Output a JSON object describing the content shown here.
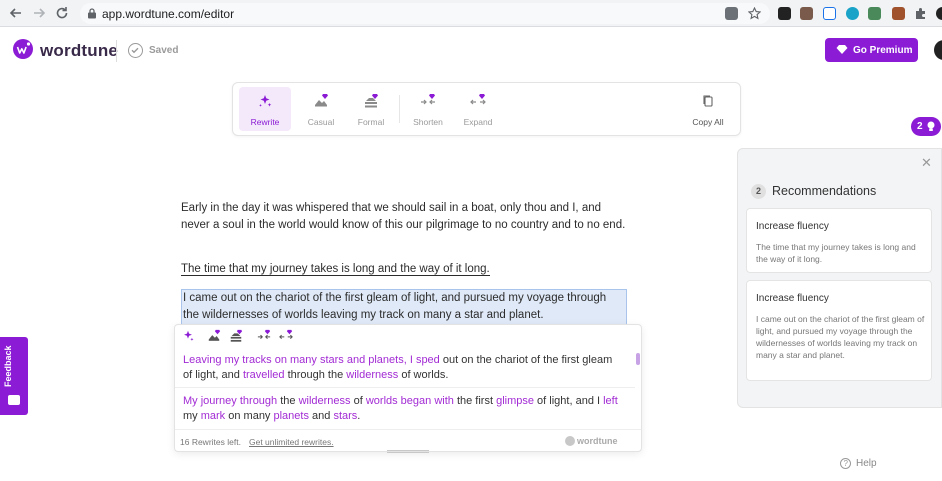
{
  "browser": {
    "url": "app.wordtune.com/editor"
  },
  "header": {
    "logo_text": "wordtune",
    "saved_label": "Saved",
    "premium_label": "Go Premium"
  },
  "toolbar": {
    "tools": [
      {
        "label": "Rewrite",
        "icon": "sparkle-icon",
        "active": true
      },
      {
        "label": "Casual",
        "icon": "casual-icon",
        "active": false
      },
      {
        "label": "Formal",
        "icon": "formal-icon",
        "active": false
      },
      {
        "label": "Shorten",
        "icon": "shorten-icon",
        "active": false
      },
      {
        "label": "Expand",
        "icon": "expand-icon",
        "active": false
      }
    ],
    "copy_all_label": "Copy All"
  },
  "editor": {
    "paragraph1": "Early in the day it was whispered that we should sail in a boat, only thou and I, and never a soul in the world would know of this our pilgrimage to no country and to no end.",
    "paragraph2": "The time that my journey takes is long and the way of it long.",
    "paragraph3_selected": "I came out on the chariot of the first gleam of light, and pursued my voyage through the wildernesses of worlds leaving my track on many a star and planet."
  },
  "popup": {
    "suggestions": [
      [
        {
          "t": "Leaving my tracks on many stars and planets, I sped",
          "h": true
        },
        {
          "t": " out on the chariot of the first gleam of light, and ",
          "h": false
        },
        {
          "t": "travelled",
          "h": true
        },
        {
          "t": " through the ",
          "h": false
        },
        {
          "t": "wilderness",
          "h": true
        },
        {
          "t": " of worlds.",
          "h": false
        }
      ],
      [
        {
          "t": "My journey through",
          "h": true
        },
        {
          "t": " the ",
          "h": false
        },
        {
          "t": "wilderness",
          "h": true
        },
        {
          "t": " of ",
          "h": false
        },
        {
          "t": "worlds began with",
          "h": true
        },
        {
          "t": " the first ",
          "h": false
        },
        {
          "t": "glimpse",
          "h": true
        },
        {
          "t": " of light, and I ",
          "h": false
        },
        {
          "t": "left",
          "h": true
        },
        {
          "t": " my ",
          "h": false
        },
        {
          "t": "mark",
          "h": true
        },
        {
          "t": " on many ",
          "h": false
        },
        {
          "t": "planets",
          "h": true
        },
        {
          "t": " and ",
          "h": false
        },
        {
          "t": "stars",
          "h": true
        },
        {
          "t": ".",
          "h": false
        }
      ]
    ],
    "rewrites_left": "16 Rewrites left.",
    "unlimited_link": "Get unlimited rewrites.",
    "brand": "wordtune"
  },
  "recommendations": {
    "badge_count": "2",
    "count": "2",
    "title": "Recommendations",
    "items": [
      {
        "heading": "Increase fluency",
        "body": "The time that my journey takes is long and the way of it long."
      },
      {
        "heading": "Increase fluency",
        "body": "I came out on the chariot of the first gleam of light, and pursued my voyage through the wildernesses of worlds leaving my track on many a star and planet."
      }
    ]
  },
  "help_label": "Help",
  "feedback_label": "Feedback",
  "colors": {
    "brand": "#8b1bd4",
    "highlight": "#a22bd4",
    "selection": "#dfe9f7"
  }
}
